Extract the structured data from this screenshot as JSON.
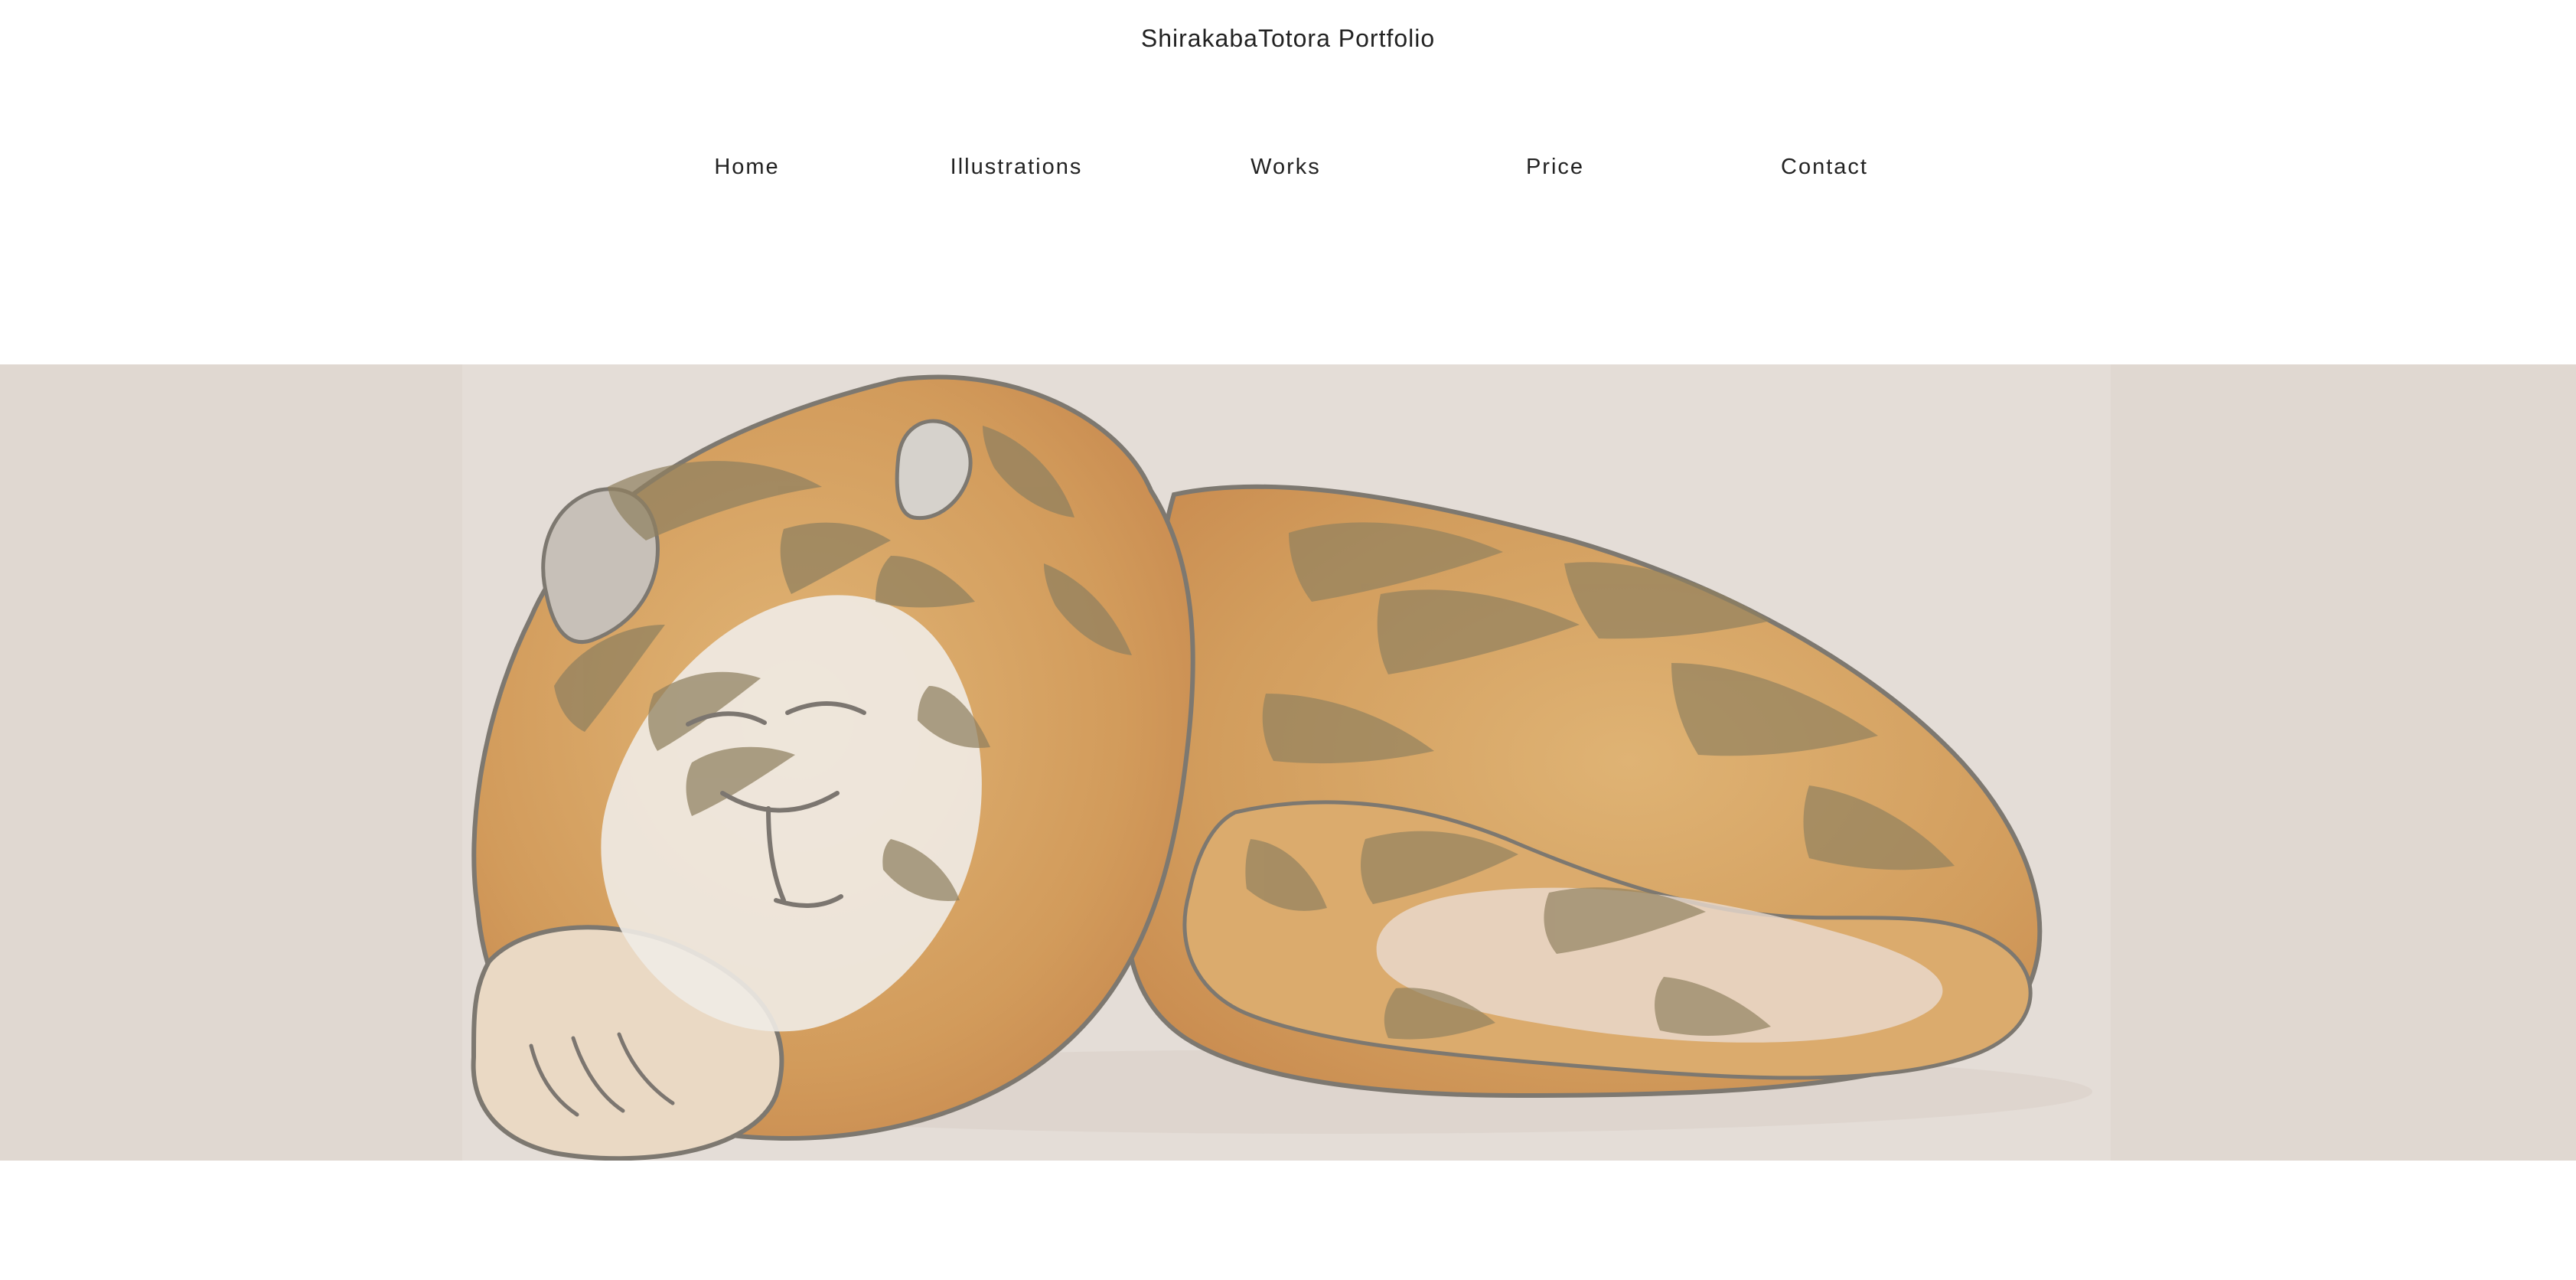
{
  "site": {
    "title": "ShirakabaTotora Portfolio"
  },
  "nav": {
    "items": [
      {
        "label": "Home"
      },
      {
        "label": "Illustrations"
      },
      {
        "label": "Works"
      },
      {
        "label": "Price"
      },
      {
        "label": "Contact"
      }
    ]
  },
  "hero": {
    "image": "sleeping-tiger-watercolor-illustration"
  },
  "colors": {
    "page_background": "#ffffff",
    "hero_background": "#e0d8d1",
    "art_background": "#e4ddd7",
    "tiger_base": "#d8a968",
    "tiger_stripes": "#8f805f",
    "tiger_outline": "#7d7870",
    "text": "#222222"
  }
}
